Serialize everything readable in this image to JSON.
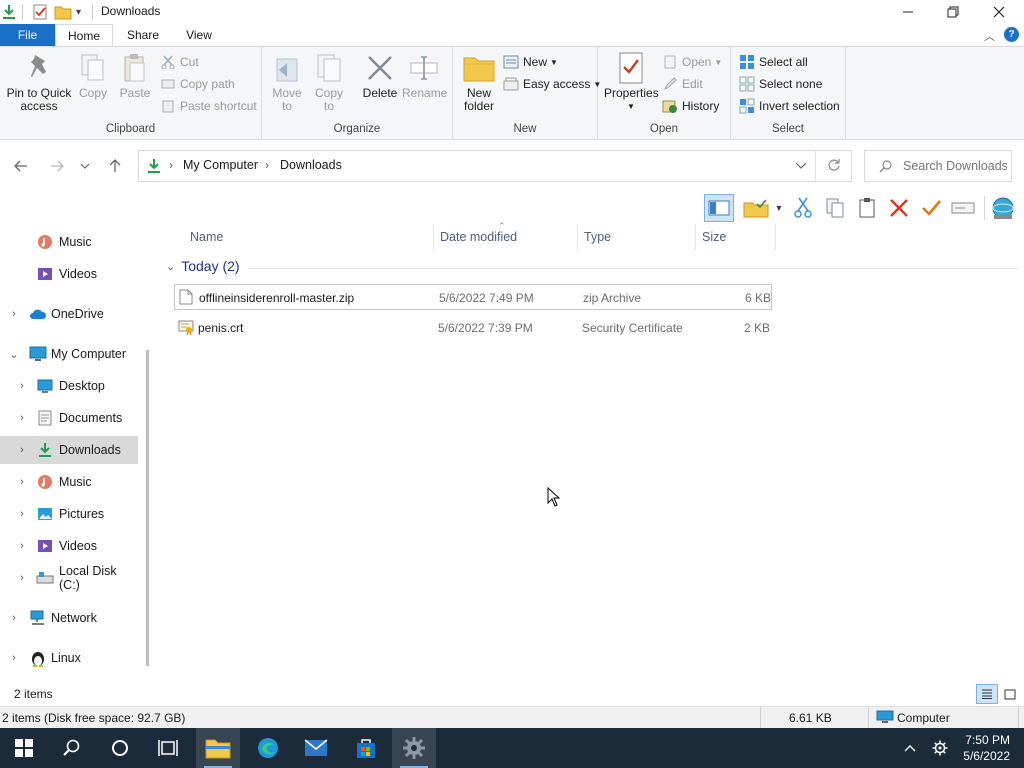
{
  "window": {
    "title": "Downloads"
  },
  "ribbon_tabs": {
    "file": "File",
    "home": "Home",
    "share": "Share",
    "view": "View"
  },
  "ribbon": {
    "clipboard": {
      "label": "Clipboard",
      "pin": "Pin to Quick access",
      "copy": "Copy",
      "paste": "Paste",
      "cut": "Cut",
      "copy_path": "Copy path",
      "paste_shortcut": "Paste shortcut"
    },
    "organize": {
      "label": "Organize",
      "move_to": "Move to",
      "copy_to": "Copy to",
      "delete": "Delete",
      "rename": "Rename"
    },
    "new": {
      "label": "New",
      "new_folder": "New folder",
      "new_item": "New",
      "easy_access": "Easy access"
    },
    "open": {
      "label": "Open",
      "properties": "Properties",
      "open": "Open",
      "edit": "Edit",
      "history": "History"
    },
    "select": {
      "label": "Select",
      "select_all": "Select all",
      "select_none": "Select none",
      "invert": "Invert selection"
    }
  },
  "address": {
    "crumbs": [
      "My Computer",
      "Downloads"
    ],
    "search_placeholder": "Search Downloads"
  },
  "nav": {
    "music": "Music",
    "videos": "Videos",
    "onedrive": "OneDrive",
    "my_computer": "My Computer",
    "desktop": "Desktop",
    "documents": "Documents",
    "downloads": "Downloads",
    "music2": "Music",
    "pictures": "Pictures",
    "videos2": "Videos",
    "local_disk": "Local Disk (C:)",
    "network": "Network",
    "linux": "Linux"
  },
  "columns": {
    "name": "Name",
    "date": "Date modified",
    "type": "Type",
    "size": "Size"
  },
  "group": {
    "label": "Today (2)"
  },
  "files": [
    {
      "name": "offlineinsiderenroll-master.zip",
      "date": "5/6/2022 7:49 PM",
      "type": "zip Archive",
      "size": "6 KB"
    },
    {
      "name": "penis.crt",
      "date": "5/6/2022 7:39 PM",
      "type": "Security Certificate",
      "size": "2 KB"
    }
  ],
  "status": {
    "items": "2 items",
    "details": "2 items (Disk free space: 92.7 GB)",
    "size": "6.61 KB",
    "location": "Computer"
  },
  "taskbar": {
    "time": "7:50 PM",
    "date": "5/6/2022"
  },
  "colors": {
    "accent": "#1a6fc6",
    "folder": "#f2c84b",
    "taskbar": "#1c2b3a"
  }
}
